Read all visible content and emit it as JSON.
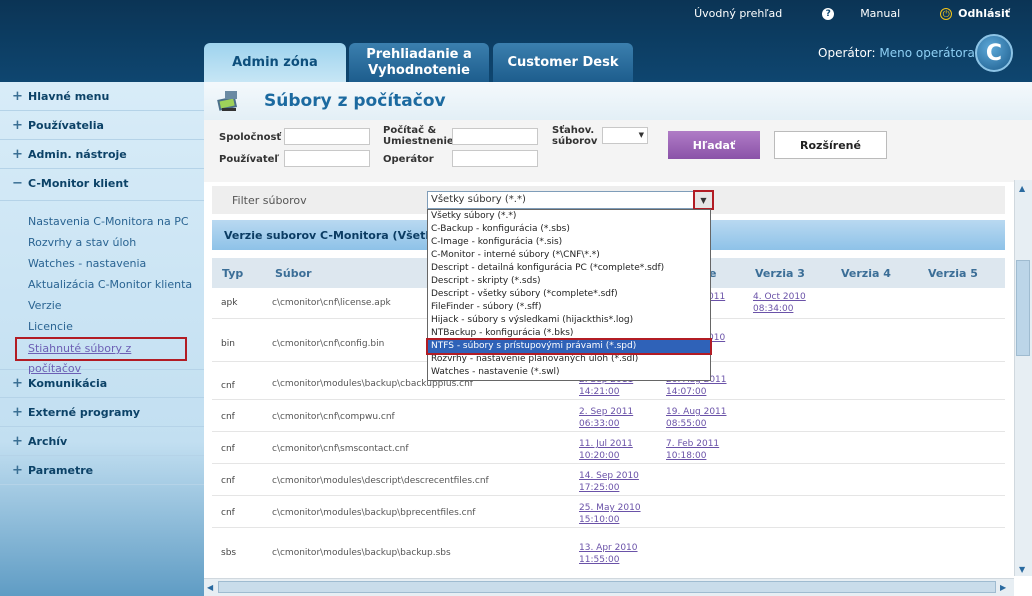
{
  "top_nav": {
    "overview": "Úvodný prehľad",
    "manual": "Manual",
    "logout": "Odhlásiť"
  },
  "tabs": [
    {
      "label": "Admin zóna"
    },
    {
      "label": "Prehliadanie a Vyhodnotenie"
    },
    {
      "label": "Customer Desk"
    }
  ],
  "operator": {
    "prefix": "Operátor:",
    "name": "Meno operátora"
  },
  "logo_letter": "C",
  "sidebar": {
    "sections_top": [
      {
        "label": "Hlavné menu",
        "marker": "+"
      },
      {
        "label": "Používatelia",
        "marker": "+"
      },
      {
        "label": "Admin. nástroje",
        "marker": "+"
      },
      {
        "label": "C-Monitor klient",
        "marker": "−"
      }
    ],
    "sub_items": [
      {
        "label": "Nastavenia C-Monitora na PC"
      },
      {
        "label": "Rozvrhy a stav úloh"
      },
      {
        "label": "Watches - nastavenia"
      },
      {
        "label": "Aktualizácia C-Monitor klienta"
      },
      {
        "label": "Verzie"
      },
      {
        "label": "Licencie"
      },
      {
        "label": "Stiahnuté súbory z počítačov"
      }
    ],
    "sections_bottom": [
      {
        "label": "Komunikácia",
        "marker": "+"
      },
      {
        "label": "Externé programy",
        "marker": "+"
      },
      {
        "label": "Archív",
        "marker": "+"
      },
      {
        "label": "Parametre",
        "marker": "+"
      }
    ]
  },
  "page_title": "Súbory z počítačov",
  "form": {
    "company": "Spoločnosť",
    "user": "Používateľ",
    "computer": "Počítač & Umiestnenie",
    "operator": "Operátor",
    "download": "Sťahov. súborov",
    "search": "Hľadať",
    "advanced": "Rozšírené"
  },
  "filter": {
    "label": "Filter súborov",
    "selected": "Všetky súbory (*.*)"
  },
  "section_title": "Verzie suborov C-Monitora (Všetky s",
  "table": {
    "headers": [
      "Typ",
      "Súbor",
      "",
      "Verzia 3",
      "Verzia 4",
      "Verzia 5"
    ],
    "rows": [
      {
        "typ": "apk",
        "file": "c\\cmonitor\\cnf\\license.apk",
        "v1": "",
        "v2": [
          "011",
          ""
        ],
        "v3": [
          "4. Oct 2010",
          "08:34:00"
        ]
      },
      {
        "typ": "bin",
        "file": "c\\cmonitor\\cnf\\config.bin",
        "v1": "",
        "v2": [
          "010",
          ""
        ],
        "v3": [
          "",
          ""
        ]
      },
      {
        "typ": "cnf",
        "file": "c\\cmonitor\\modules\\backup\\cbackupplus.cnf",
        "v1": [
          "2. Sep 2011",
          "14:21:00"
        ],
        "v2": [
          "20. Aug 2011",
          "14:07:00"
        ]
      },
      {
        "typ": "cnf",
        "file": "c\\cmonitor\\cnf\\compwu.cnf",
        "v1": [
          "2. Sep 2011",
          "06:33:00"
        ],
        "v2": [
          "19. Aug 2011",
          "08:55:00"
        ]
      },
      {
        "typ": "cnf",
        "file": "c\\cmonitor\\cnf\\smscontact.cnf",
        "v1": [
          "11. Jul 2011",
          "10:20:00"
        ],
        "v2": [
          "7. Feb 2011",
          "10:18:00"
        ]
      },
      {
        "typ": "cnf",
        "file": "c\\cmonitor\\modules\\descript\\descrecentfiles.cnf",
        "v1": [
          "14. Sep 2010",
          "17:25:00"
        ],
        "v2": [
          "",
          ""
        ]
      },
      {
        "typ": "cnf",
        "file": "c\\cmonitor\\modules\\backup\\bprecentfiles.cnf",
        "v1": [
          "25. May 2010",
          "15:10:00"
        ],
        "v2": [
          "",
          ""
        ]
      },
      {
        "typ": "sbs",
        "file": "c\\cmonitor\\modules\\backup\\backup.sbs",
        "v1": [
          "13. Apr 2010",
          "11:55:00"
        ],
        "v2": [
          "",
          ""
        ]
      }
    ]
  },
  "dropdown_options": [
    "Všetky súbory (*.*)",
    "C-Backup - konfigurácia (*.sbs)",
    "C-Image - konfigurácia (*.sis)",
    "C-Monitor - interné súbory (*\\CNF\\*.*)",
    "Descript - detailná konfigurácia PC (*complete*.sdf)",
    "Descript - skripty (*.sds)",
    "Descript - všetky súbory (*complete*.sdf)",
    "FileFinder - súbory (*.sff)",
    "Hijack - súbory s výsledkami (hijackthis*.log)",
    "NTBackup - konfigurácia (*.bks)",
    "NTFS - súbory s prístupovými právami (*.spd)",
    "Rozvrhy - nastavenie plánovaných úloh (*.sdl)",
    "Watches - nastavenie (*.swl)"
  ],
  "dropdown_highlight_index": 10,
  "colors": {
    "accent_red": "#b21c24",
    "link_purple": "#6a52a8",
    "header_blue": "#0e4670"
  }
}
